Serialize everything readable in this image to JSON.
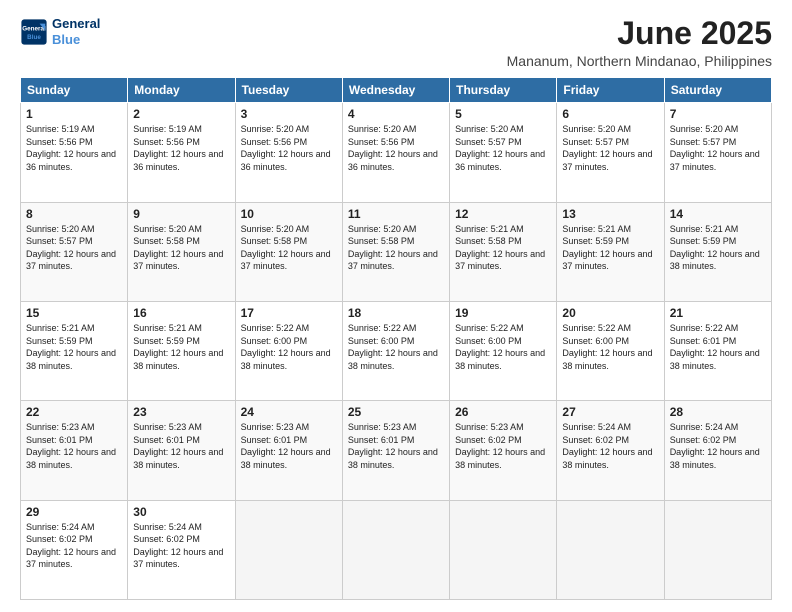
{
  "logo": {
    "line1": "General",
    "line2": "Blue"
  },
  "title": "June 2025",
  "subtitle": "Mananum, Northern Mindanao, Philippines",
  "headers": [
    "Sunday",
    "Monday",
    "Tuesday",
    "Wednesday",
    "Thursday",
    "Friday",
    "Saturday"
  ],
  "weeks": [
    [
      {
        "day": "1",
        "sunrise": "5:19 AM",
        "sunset": "5:56 PM",
        "daylight": "12 hours and 36 minutes."
      },
      {
        "day": "2",
        "sunrise": "5:19 AM",
        "sunset": "5:56 PM",
        "daylight": "12 hours and 36 minutes."
      },
      {
        "day": "3",
        "sunrise": "5:20 AM",
        "sunset": "5:56 PM",
        "daylight": "12 hours and 36 minutes."
      },
      {
        "day": "4",
        "sunrise": "5:20 AM",
        "sunset": "5:56 PM",
        "daylight": "12 hours and 36 minutes."
      },
      {
        "day": "5",
        "sunrise": "5:20 AM",
        "sunset": "5:57 PM",
        "daylight": "12 hours and 36 minutes."
      },
      {
        "day": "6",
        "sunrise": "5:20 AM",
        "sunset": "5:57 PM",
        "daylight": "12 hours and 37 minutes."
      },
      {
        "day": "7",
        "sunrise": "5:20 AM",
        "sunset": "5:57 PM",
        "daylight": "12 hours and 37 minutes."
      }
    ],
    [
      {
        "day": "8",
        "sunrise": "5:20 AM",
        "sunset": "5:57 PM",
        "daylight": "12 hours and 37 minutes."
      },
      {
        "day": "9",
        "sunrise": "5:20 AM",
        "sunset": "5:58 PM",
        "daylight": "12 hours and 37 minutes."
      },
      {
        "day": "10",
        "sunrise": "5:20 AM",
        "sunset": "5:58 PM",
        "daylight": "12 hours and 37 minutes."
      },
      {
        "day": "11",
        "sunrise": "5:20 AM",
        "sunset": "5:58 PM",
        "daylight": "12 hours and 37 minutes."
      },
      {
        "day": "12",
        "sunrise": "5:21 AM",
        "sunset": "5:58 PM",
        "daylight": "12 hours and 37 minutes."
      },
      {
        "day": "13",
        "sunrise": "5:21 AM",
        "sunset": "5:59 PM",
        "daylight": "12 hours and 37 minutes."
      },
      {
        "day": "14",
        "sunrise": "5:21 AM",
        "sunset": "5:59 PM",
        "daylight": "12 hours and 38 minutes."
      }
    ],
    [
      {
        "day": "15",
        "sunrise": "5:21 AM",
        "sunset": "5:59 PM",
        "daylight": "12 hours and 38 minutes."
      },
      {
        "day": "16",
        "sunrise": "5:21 AM",
        "sunset": "5:59 PM",
        "daylight": "12 hours and 38 minutes."
      },
      {
        "day": "17",
        "sunrise": "5:22 AM",
        "sunset": "6:00 PM",
        "daylight": "12 hours and 38 minutes."
      },
      {
        "day": "18",
        "sunrise": "5:22 AM",
        "sunset": "6:00 PM",
        "daylight": "12 hours and 38 minutes."
      },
      {
        "day": "19",
        "sunrise": "5:22 AM",
        "sunset": "6:00 PM",
        "daylight": "12 hours and 38 minutes."
      },
      {
        "day": "20",
        "sunrise": "5:22 AM",
        "sunset": "6:00 PM",
        "daylight": "12 hours and 38 minutes."
      },
      {
        "day": "21",
        "sunrise": "5:22 AM",
        "sunset": "6:01 PM",
        "daylight": "12 hours and 38 minutes."
      }
    ],
    [
      {
        "day": "22",
        "sunrise": "5:23 AM",
        "sunset": "6:01 PM",
        "daylight": "12 hours and 38 minutes."
      },
      {
        "day": "23",
        "sunrise": "5:23 AM",
        "sunset": "6:01 PM",
        "daylight": "12 hours and 38 minutes."
      },
      {
        "day": "24",
        "sunrise": "5:23 AM",
        "sunset": "6:01 PM",
        "daylight": "12 hours and 38 minutes."
      },
      {
        "day": "25",
        "sunrise": "5:23 AM",
        "sunset": "6:01 PM",
        "daylight": "12 hours and 38 minutes."
      },
      {
        "day": "26",
        "sunrise": "5:23 AM",
        "sunset": "6:02 PM",
        "daylight": "12 hours and 38 minutes."
      },
      {
        "day": "27",
        "sunrise": "5:24 AM",
        "sunset": "6:02 PM",
        "daylight": "12 hours and 38 minutes."
      },
      {
        "day": "28",
        "sunrise": "5:24 AM",
        "sunset": "6:02 PM",
        "daylight": "12 hours and 38 minutes."
      }
    ],
    [
      {
        "day": "29",
        "sunrise": "5:24 AM",
        "sunset": "6:02 PM",
        "daylight": "12 hours and 37 minutes."
      },
      {
        "day": "30",
        "sunrise": "5:24 AM",
        "sunset": "6:02 PM",
        "daylight": "12 hours and 37 minutes."
      },
      null,
      null,
      null,
      null,
      null
    ]
  ]
}
